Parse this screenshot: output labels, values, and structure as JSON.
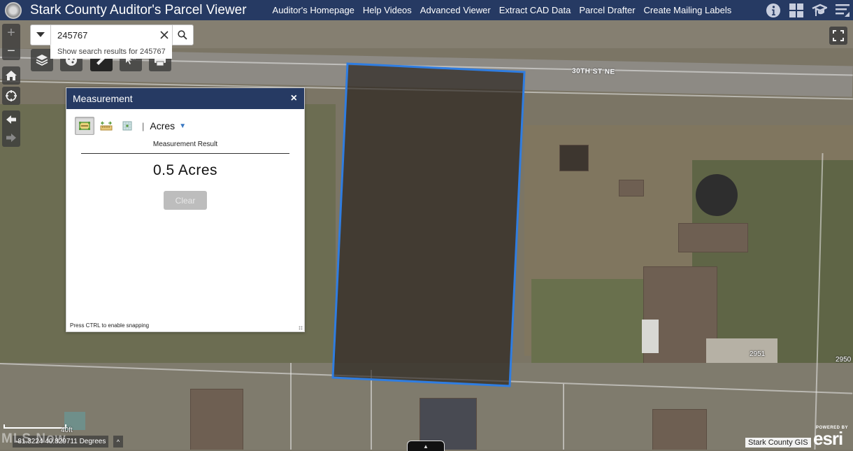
{
  "header": {
    "title": "Stark County Auditor's Parcel Viewer",
    "nav": [
      {
        "label": "Auditor's Homepage"
      },
      {
        "label": "Help Videos"
      },
      {
        "label": "Advanced Viewer"
      },
      {
        "label": "Extract CAD Data"
      },
      {
        "label": "Parcel Drafter"
      },
      {
        "label": "Create Mailing Labels"
      }
    ],
    "icons": [
      "info-icon",
      "apps-grid-icon",
      "education-cap-icon",
      "menu-icon"
    ]
  },
  "search": {
    "value": "245767",
    "suggestion": "Show search results for 245767"
  },
  "map": {
    "zoom_in": "+",
    "zoom_out": "−",
    "street_label": "30TH ST NE",
    "address_labels": [
      "2951",
      "2950"
    ],
    "scale_label": "40ft",
    "coordinates": "-81.3224 40.829711 Degrees",
    "coords_toggle": "^",
    "attribution": "Stark County GIS",
    "esri_powered": "POWERED BY",
    "esri_logo": "esri",
    "watermark": "MLS Now",
    "bottom_toggle": "▲",
    "parcel_outline_color": "#2f7de1"
  },
  "measurement": {
    "title": "Measurement",
    "close": "×",
    "tools": [
      "area-tool",
      "distance-tool",
      "location-tool"
    ],
    "separator": "|",
    "unit": "Acres",
    "result_label": "Measurement Result",
    "result_value": "0.5 Acres",
    "clear_label": "Clear",
    "snap_hint": "Press CTRL to enable snapping"
  }
}
